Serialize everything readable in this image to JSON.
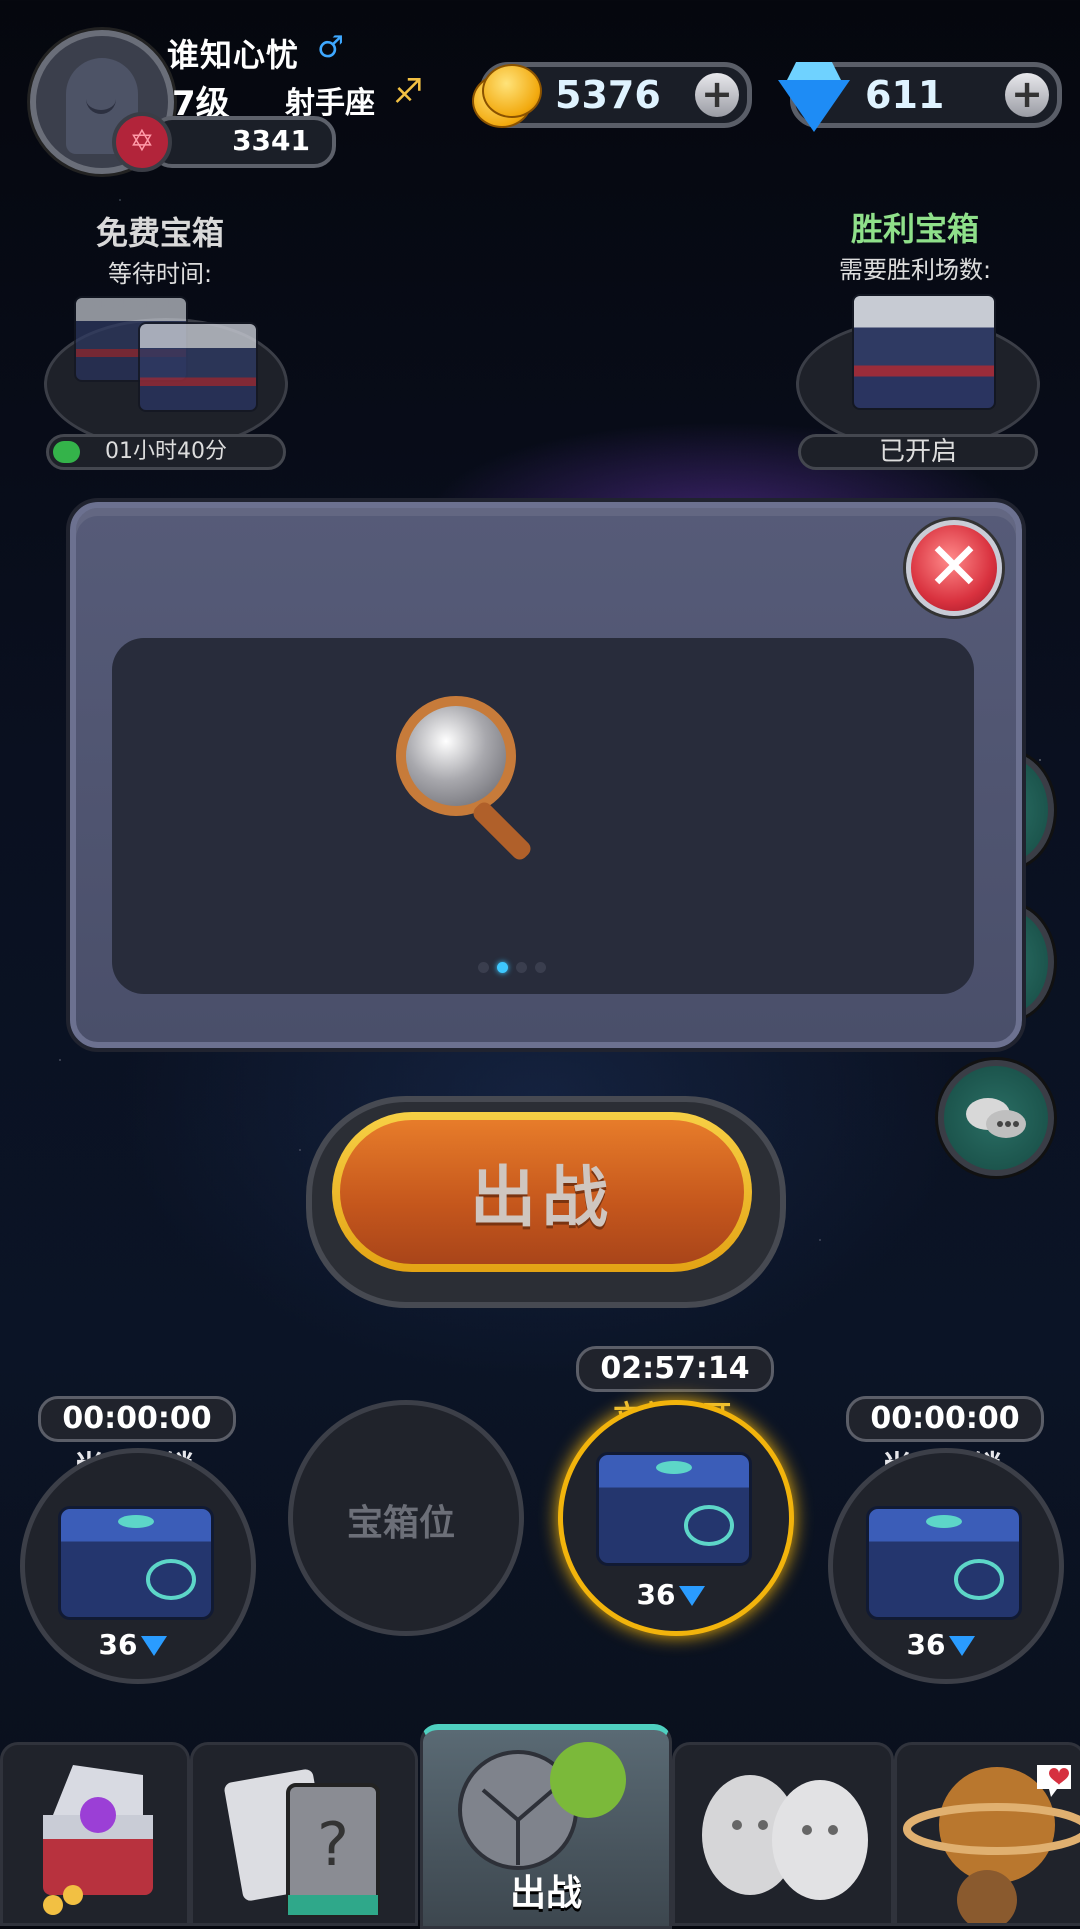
{
  "header": {
    "username": "谁知心忧",
    "gender_symbol": "♂",
    "level": "7级",
    "zodiac": "射手座",
    "zodiac_symbol": "♐",
    "rank_points": "3341",
    "rank_badge_symbol": "✡",
    "coins": "5376",
    "gems": "611",
    "plus_symbol": "+"
  },
  "free_chest": {
    "title": "免费宝箱",
    "subtitle": "等待时间:",
    "timer": "01小时40分",
    "progress": 0.12
  },
  "victory_chest": {
    "title": "胜利宝箱",
    "subtitle": "需要胜利场数:",
    "status": "已开启"
  },
  "modal": {
    "close_symbol": "✕",
    "page_count": 4,
    "active_page": 1
  },
  "battle_button": {
    "label": "出战"
  },
  "chest_slots": [
    {
      "timer": "00:00:00",
      "label": "尚未解锁",
      "price": "36"
    },
    {
      "empty_label": "宝箱位"
    },
    {
      "timer": "02:57:14",
      "label": "立刻打开",
      "price": "36"
    },
    {
      "timer": "00:00:00",
      "label": "尚未解锁",
      "price": "36"
    }
  ],
  "bottom_nav": [
    {
      "icon": "treasure-chest-icon",
      "label": ""
    },
    {
      "icon": "mystery-card-icon",
      "label": ""
    },
    {
      "icon": "battle-planet-icon",
      "label": "出战"
    },
    {
      "icon": "friends-icon",
      "label": ""
    },
    {
      "icon": "planet-icon",
      "label": ""
    }
  ],
  "colors": {
    "accent": "#4fd0c0",
    "battle_orange": "#e77c2a",
    "gold": "#f2b40c",
    "gem_blue": "#2a9cff"
  }
}
